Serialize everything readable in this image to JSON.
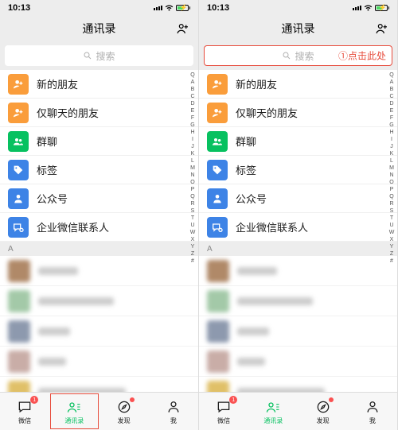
{
  "status": {
    "time": "10:13"
  },
  "header": {
    "title": "通讯录"
  },
  "search": {
    "placeholder": "搜索"
  },
  "annotation": {
    "step1": "①点击此处"
  },
  "special_rows": [
    {
      "key": "new_friends",
      "label": "新的朋友",
      "color": "#fa9d3b",
      "icon": "person-plus"
    },
    {
      "key": "chat_only",
      "label": "仅聊天的朋友",
      "color": "#fa9d3b",
      "icon": "person-plus"
    },
    {
      "key": "group_chat",
      "label": "群聊",
      "color": "#07c160",
      "icon": "group"
    },
    {
      "key": "tags",
      "label": "标签",
      "color": "#3d83e6",
      "icon": "tag"
    },
    {
      "key": "official",
      "label": "公众号",
      "color": "#3d83e6",
      "icon": "person"
    },
    {
      "key": "wecom",
      "label": "企业微信联系人",
      "color": "#3d83e6",
      "icon": "wecom"
    }
  ],
  "section_letter": "A",
  "index_letters": [
    "Q",
    "A",
    "B",
    "C",
    "D",
    "E",
    "F",
    "G",
    "H",
    "I",
    "J",
    "K",
    "L",
    "M",
    "N",
    "O",
    "P",
    "Q",
    "R",
    "S",
    "T",
    "U",
    "W",
    "X",
    "Y",
    "Z",
    "#"
  ],
  "blurred_contacts": [
    {
      "avatar_color": "#b08968",
      "name_w": 50
    },
    {
      "avatar_color": "#a3c9a8",
      "name_w": 95
    },
    {
      "avatar_color": "#8d99ae",
      "name_w": 40
    },
    {
      "avatar_color": "#c9ada7",
      "name_w": 35
    },
    {
      "avatar_color": "#e0c068",
      "name_w": 110
    }
  ],
  "tabs": [
    {
      "key": "wechat",
      "label": "微信",
      "badge": "1"
    },
    {
      "key": "contacts",
      "label": "通讯录",
      "active": true,
      "highlighted_left": true
    },
    {
      "key": "discover",
      "label": "发现",
      "dot": true
    },
    {
      "key": "me",
      "label": "我"
    }
  ]
}
